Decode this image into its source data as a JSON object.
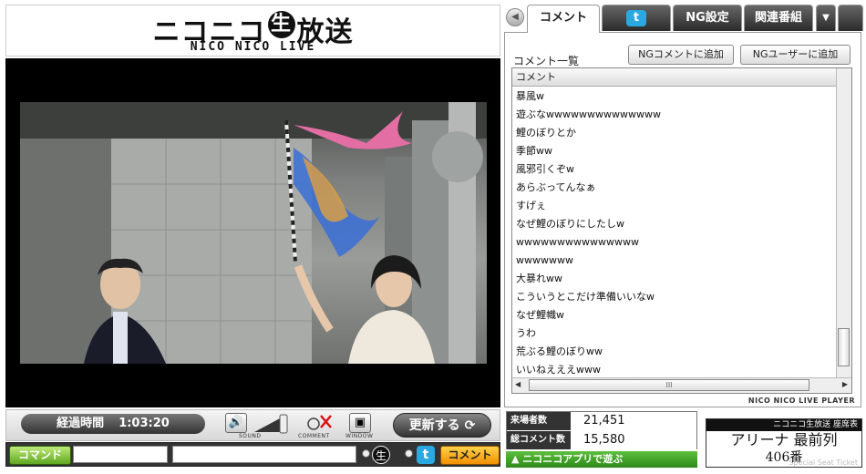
{
  "logo": {
    "title_a": "ニコニコ",
    "title_nama": "生",
    "title_b": "放送",
    "subtitle": "NICO NICO LIVE"
  },
  "player": {
    "elapsed_label": "経過時間",
    "elapsed_time": "1:03:20",
    "sound_label": "SOUND",
    "comment_label": "COMMENT",
    "window_label": "WINDOW",
    "refresh_label": "更新する"
  },
  "command_bar": {
    "command_button": "コマンド",
    "command_value": "",
    "comment_value": "",
    "send_button": "コメント"
  },
  "tabs": [
    {
      "label": "コメント"
    },
    {
      "label": "twitter"
    },
    {
      "label": "NG設定"
    },
    {
      "label": "関連番組"
    }
  ],
  "comments_panel": {
    "title": "コメント一覧",
    "ng_comment_button": "NGコメントに追加",
    "ng_user_button": "NGユーザーに追加",
    "column_header": "コメント",
    "rows": [
      "暴風w",
      "遊ぶなwwwwwwwwwwwwww",
      "鯉のぼりとか",
      "季節ww",
      "風邪引くぞw",
      "あらぶってんなぁ",
      "すげぇ",
      "なぜ鯉のぼりにしたしw",
      "wwwwwwwwwwwwwww",
      "wwwwwww",
      "大暴れww",
      "こういうとこだけ準備いいなw",
      "なぜ鯉幟w",
      "うわ",
      "荒ぶる鯉のぼりww",
      "いいねえええwww"
    ],
    "scroll_grip": "III",
    "player_label": "NICO NICO LIVE PLAYER"
  },
  "stats": {
    "visitors_label": "来場者数",
    "visitors_value": "21,451",
    "comments_label": "総コメント数",
    "comments_value": "15,580",
    "app_link": "ニコニコアプリで遊ぶ"
  },
  "ticket": {
    "header": "ニコニコ生放送 座席表",
    "seat": "アリーナ 最前列",
    "number": "406番",
    "footer": "Special Seat Ticket"
  },
  "colors": {
    "accent_green": "#5fa820",
    "send_orange": "#f09000",
    "twitter_blue": "#2aa9e0"
  },
  "icons": [
    "sound-icon",
    "volume-slider",
    "comment-off-icon",
    "window-icon",
    "refresh-icon",
    "twitter-icon",
    "back-arrow-icon",
    "dropdown-arrow-icon"
  ]
}
